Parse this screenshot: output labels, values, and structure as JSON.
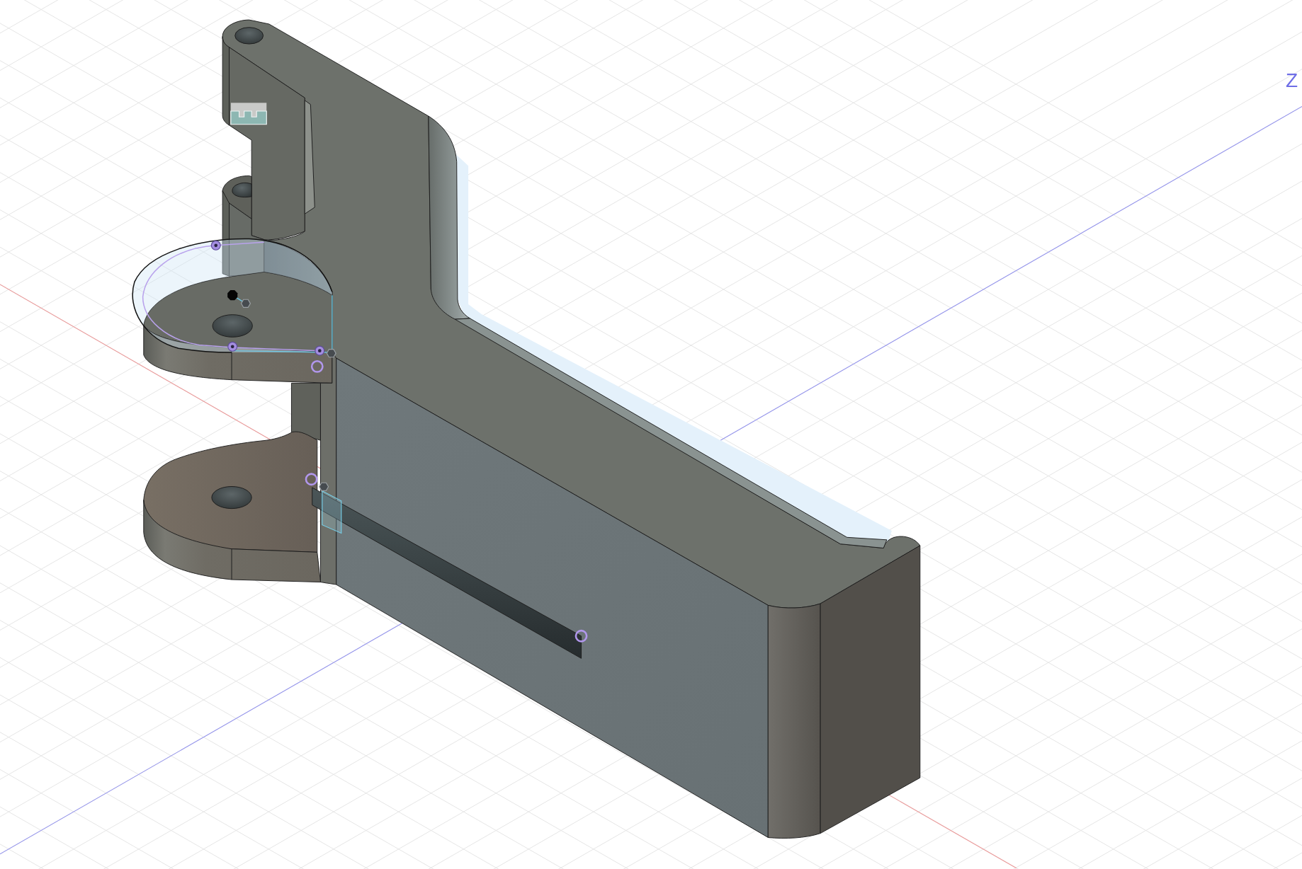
{
  "viewport": {
    "axis_label": "Z"
  }
}
